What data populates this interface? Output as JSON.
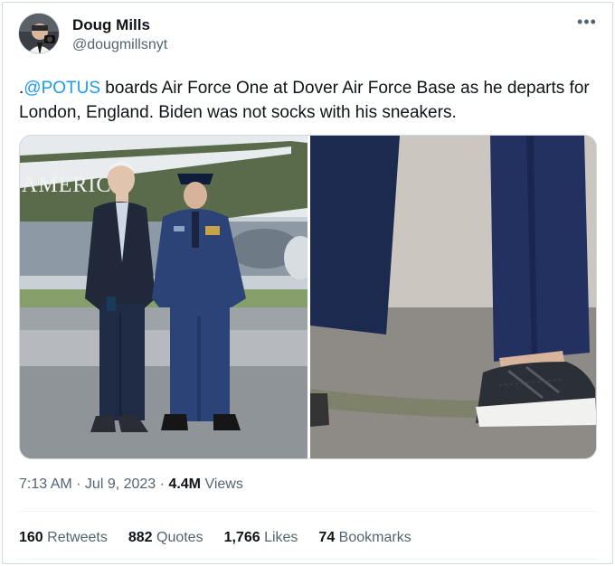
{
  "author": {
    "display_name": "Doug Mills",
    "handle": "@dougmillsnyt",
    "avatar_icon": "photographer-avatar"
  },
  "more_icon": "more-horizontal-icon",
  "tweet": {
    "prefix": ".",
    "mention": "@POTUS",
    "text": " boards Air Force One at Dover Air Force Base as he departs for London, England. Biden was not socks with his sneakers."
  },
  "media": {
    "left_photo": "photo-biden-walking-with-officer",
    "left_photo_plane_text": "AMERIC",
    "right_photo": "photo-sneakers-closeup"
  },
  "meta": {
    "time": "7:13 AM",
    "separator": " · ",
    "date": "Jul 9, 2023",
    "views_count": "4.4M",
    "views_label": " Views"
  },
  "stats": {
    "retweets_count": "160",
    "retweets_label": " Retweets",
    "quotes_count": "882",
    "quotes_label": " Quotes",
    "likes_count": "1,766",
    "likes_label": " Likes",
    "bookmarks_count": "74",
    "bookmarks_label": " Bookmarks"
  },
  "colors": {
    "link": "#1d9bf0",
    "text": "#0f1419",
    "secondary": "#536471"
  }
}
